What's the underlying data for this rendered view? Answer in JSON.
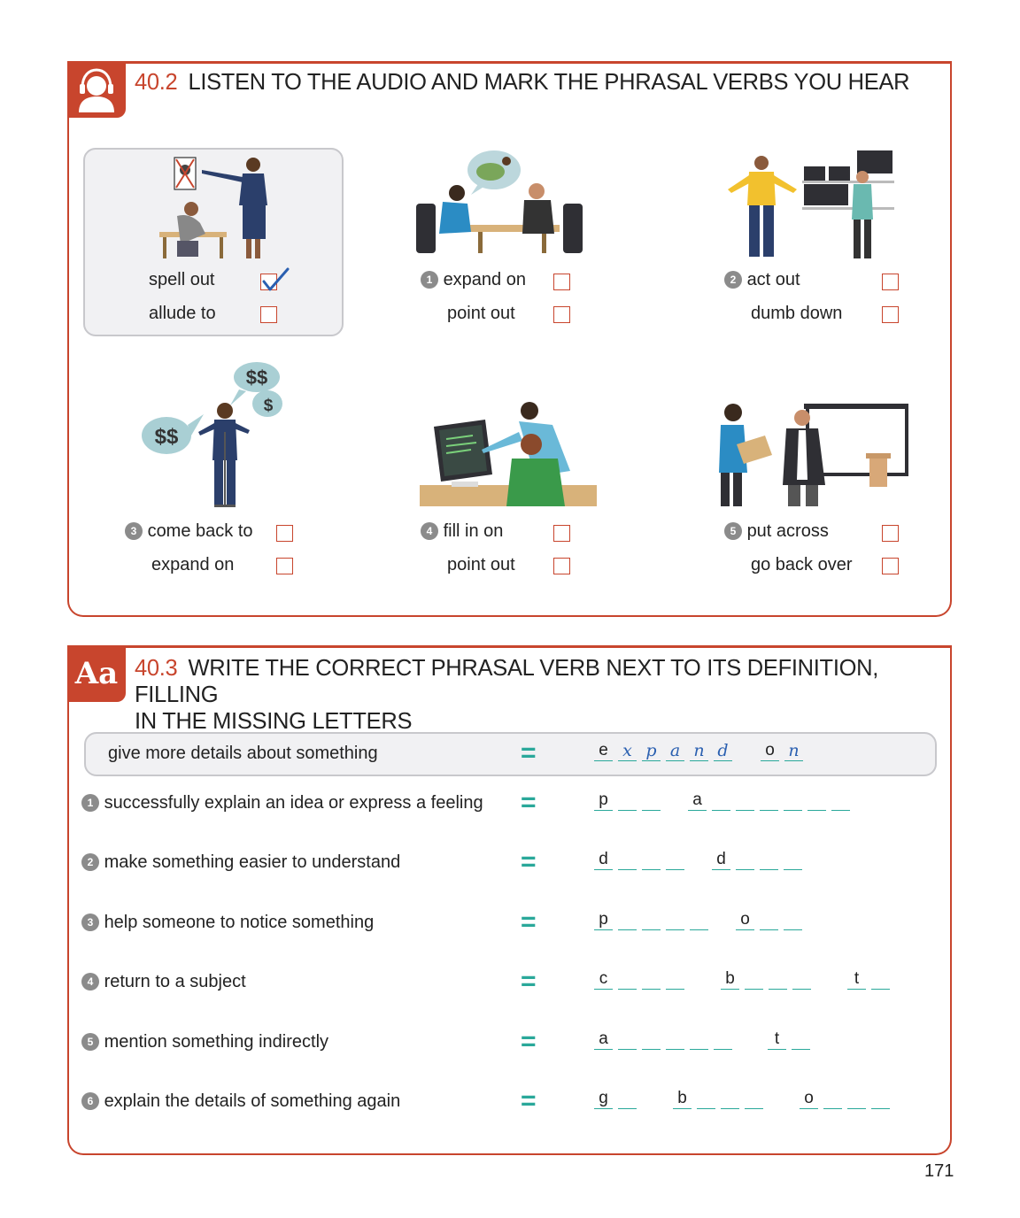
{
  "colors": {
    "accent": "#c8452d",
    "answer_line": "#2aa89a",
    "handwriting": "#2a5fb0"
  },
  "section1": {
    "number": "40.2",
    "title": "LISTEN TO THE AUDIO AND MARK THE PHRASAL VERBS YOU HEAR",
    "icon": "headphones-person-icon",
    "items": [
      {
        "n": "",
        "option_a": "spell out",
        "option_b": "allude to",
        "checked": "a"
      },
      {
        "n": "1",
        "option_a": "expand on",
        "option_b": "point out",
        "checked": ""
      },
      {
        "n": "2",
        "option_a": "act out",
        "option_b": "dumb down",
        "checked": ""
      },
      {
        "n": "3",
        "option_a": "come back to",
        "option_b": "expand on",
        "checked": ""
      },
      {
        "n": "4",
        "option_a": "fill in on",
        "option_b": "point out",
        "checked": ""
      },
      {
        "n": "5",
        "option_a": "put across",
        "option_b": "go back over",
        "checked": ""
      }
    ],
    "bubbles": [
      "$$",
      "$",
      "$$"
    ]
  },
  "section2": {
    "badge": "Aa",
    "number": "40.3",
    "title_line1": "WRITE THE CORRECT PHRASAL VERB NEXT TO ITS DEFINITION, FILLING",
    "title_line2": "IN THE MISSING LETTERS",
    "equals": "=",
    "rows": [
      {
        "n": "",
        "definition": "give more details about something",
        "words": [
          [
            "e",
            "x",
            "p",
            "a",
            "n",
            "d"
          ],
          [
            "o",
            "n"
          ]
        ]
      },
      {
        "n": "1",
        "definition": "successfully explain an idea or express a feeling",
        "words": [
          [
            "p",
            "",
            ""
          ],
          [
            "a",
            "",
            "",
            "",
            "",
            "",
            ""
          ]
        ]
      },
      {
        "n": "2",
        "definition": "make something easier to understand",
        "words": [
          [
            "d",
            "",
            "",
            ""
          ],
          [
            "d",
            "",
            "",
            ""
          ]
        ]
      },
      {
        "n": "3",
        "definition": "help someone to notice something",
        "words": [
          [
            "p",
            "",
            "",
            "",
            ""
          ],
          [
            "o",
            "",
            ""
          ]
        ]
      },
      {
        "n": "4",
        "definition": "return to a subject",
        "words": [
          [
            "c",
            "",
            "",
            ""
          ],
          [
            "b",
            "",
            "",
            ""
          ],
          [
            "t",
            ""
          ]
        ]
      },
      {
        "n": "5",
        "definition": "mention something indirectly",
        "words": [
          [
            "a",
            "",
            "",
            "",
            "",
            ""
          ],
          [
            "t",
            ""
          ]
        ]
      },
      {
        "n": "6",
        "definition": "explain the details of something again",
        "words": [
          [
            "g",
            ""
          ],
          [
            "b",
            "",
            "",
            ""
          ],
          [
            "o",
            "",
            "",
            ""
          ]
        ]
      }
    ]
  },
  "page_number": "171"
}
